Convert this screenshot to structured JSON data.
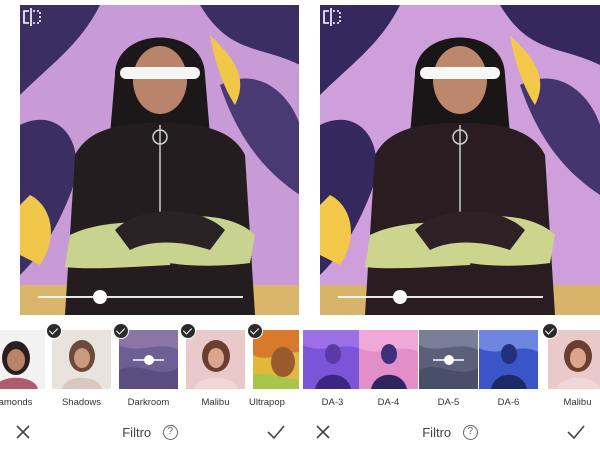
{
  "left_panel": {
    "slider": {
      "value": 0.25
    },
    "filters": [
      {
        "label": "amonds",
        "selected": true
      },
      {
        "label": "Shadows",
        "selected": true
      },
      {
        "label": "Darkroom",
        "selected": true,
        "active": true
      },
      {
        "label": "Malibu",
        "selected": true
      },
      {
        "label": "Ultrapop",
        "selected": true
      }
    ],
    "bottom_bar": {
      "title": "Filtro",
      "help": "?"
    }
  },
  "right_panel": {
    "slider": {
      "value": 0.25
    },
    "filters": [
      {
        "label": "DA-3",
        "selected": false
      },
      {
        "label": "DA-4",
        "selected": false
      },
      {
        "label": "DA-5",
        "selected": false,
        "active": true
      },
      {
        "label": "DA-6",
        "selected": false
      },
      {
        "label": "Malibu",
        "selected": true
      }
    ],
    "bottom_bar": {
      "title": "Filtro",
      "help": "?"
    }
  },
  "colors": {
    "marble_purple": "#c89ad6",
    "marble_navy": "#3b2e63",
    "marble_yellow": "#f1c74a",
    "jacket": "#1f1a1c",
    "sleeve": "#c7d38f"
  },
  "icons": [
    "close-icon",
    "checkmark-icon",
    "help-icon",
    "compare-icon",
    "slider-thumb"
  ]
}
